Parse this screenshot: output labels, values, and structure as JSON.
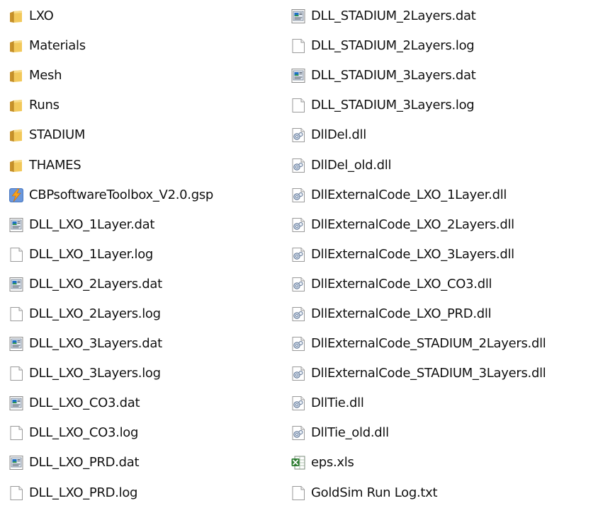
{
  "explorer": {
    "left_column": [
      {
        "name": "LXO",
        "icon": "folder-icon"
      },
      {
        "name": "Materials",
        "icon": "folder-icon"
      },
      {
        "name": "Mesh",
        "icon": "folder-icon"
      },
      {
        "name": "Runs",
        "icon": "folder-icon"
      },
      {
        "name": "STADIUM",
        "icon": "folder-icon"
      },
      {
        "name": "THAMES",
        "icon": "folder-icon"
      },
      {
        "name": "CBPsoftwareToolbox_V2.0.gsp",
        "icon": "goldsim-file-icon"
      },
      {
        "name": "DLL_LXO_1Layer.dat",
        "icon": "dat-file-icon"
      },
      {
        "name": "DLL_LXO_1Layer.log",
        "icon": "text-file-icon"
      },
      {
        "name": "DLL_LXO_2Layers.dat",
        "icon": "dat-file-icon"
      },
      {
        "name": "DLL_LXO_2Layers.log",
        "icon": "text-file-icon"
      },
      {
        "name": "DLL_LXO_3Layers.dat",
        "icon": "dat-file-icon"
      },
      {
        "name": "DLL_LXO_3Layers.log",
        "icon": "text-file-icon"
      },
      {
        "name": "DLL_LXO_CO3.dat",
        "icon": "dat-file-icon"
      },
      {
        "name": "DLL_LXO_CO3.log",
        "icon": "text-file-icon"
      },
      {
        "name": "DLL_LXO_PRD.dat",
        "icon": "dat-file-icon"
      },
      {
        "name": "DLL_LXO_PRD.log",
        "icon": "text-file-icon"
      }
    ],
    "right_column": [
      {
        "name": "DLL_STADIUM_2Layers.dat",
        "icon": "dat-file-icon"
      },
      {
        "name": "DLL_STADIUM_2Layers.log",
        "icon": "text-file-icon"
      },
      {
        "name": "DLL_STADIUM_3Layers.dat",
        "icon": "dat-file-icon"
      },
      {
        "name": "DLL_STADIUM_3Layers.log",
        "icon": "text-file-icon"
      },
      {
        "name": "DllDel.dll",
        "icon": "dll-file-icon"
      },
      {
        "name": "DllDel_old.dll",
        "icon": "dll-file-icon"
      },
      {
        "name": "DllExternalCode_LXO_1Layer.dll",
        "icon": "dll-file-icon"
      },
      {
        "name": "DllExternalCode_LXO_2Layers.dll",
        "icon": "dll-file-icon"
      },
      {
        "name": "DllExternalCode_LXO_3Layers.dll",
        "icon": "dll-file-icon"
      },
      {
        "name": "DllExternalCode_LXO_CO3.dll",
        "icon": "dll-file-icon"
      },
      {
        "name": "DllExternalCode_LXO_PRD.dll",
        "icon": "dll-file-icon"
      },
      {
        "name": "DllExternalCode_STADIUM_2Layers.dll",
        "icon": "dll-file-icon"
      },
      {
        "name": "DllExternalCode_STADIUM_3Layers.dll",
        "icon": "dll-file-icon"
      },
      {
        "name": "DllTie.dll",
        "icon": "dll-file-icon"
      },
      {
        "name": "DllTie_old.dll",
        "icon": "dll-file-icon"
      },
      {
        "name": "eps.xls",
        "icon": "excel-file-icon"
      },
      {
        "name": "GoldSim Run Log.txt",
        "icon": "text-file-icon"
      }
    ]
  },
  "colors": {
    "background": "#ffffff",
    "text": "#111111",
    "folder": "#e8b94a",
    "goldsim": "#f08a1c",
    "excel": "#2e7d32"
  }
}
